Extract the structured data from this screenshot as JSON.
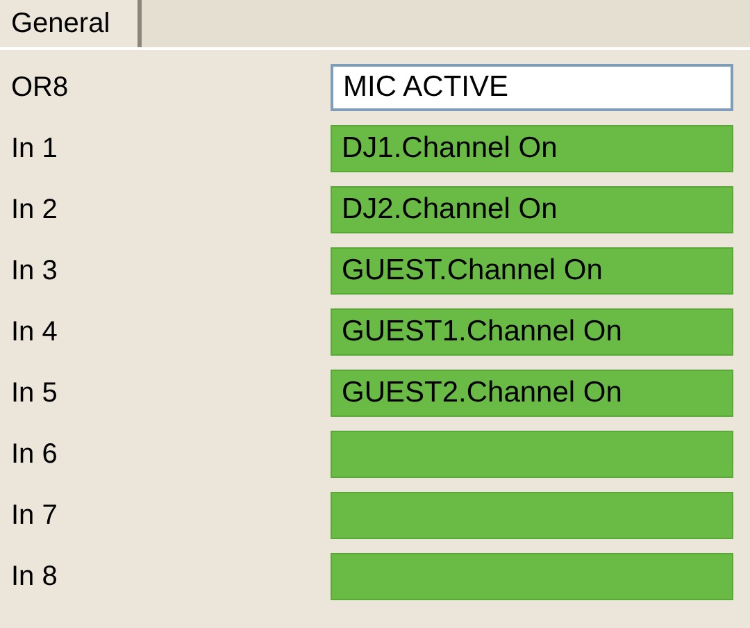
{
  "tabs": [
    {
      "label": "General",
      "selected": true
    }
  ],
  "rows": [
    {
      "label": "OR8",
      "kind": "text",
      "value": "MIC ACTIVE"
    },
    {
      "label": "In 1",
      "kind": "indicator",
      "on": true,
      "value": "DJ1.Channel On"
    },
    {
      "label": "In 2",
      "kind": "indicator",
      "on": true,
      "value": "DJ2.Channel On"
    },
    {
      "label": "In 3",
      "kind": "indicator",
      "on": true,
      "value": "GUEST.Channel On"
    },
    {
      "label": "In 4",
      "kind": "indicator",
      "on": true,
      "value": "GUEST1.Channel On"
    },
    {
      "label": "In 5",
      "kind": "indicator",
      "on": true,
      "value": "GUEST2.Channel On"
    },
    {
      "label": "In 6",
      "kind": "indicator",
      "on": true
    },
    {
      "label": "In 7",
      "kind": "indicator",
      "on": true
    },
    {
      "label": "In 8",
      "kind": "indicator",
      "on": true
    }
  ]
}
